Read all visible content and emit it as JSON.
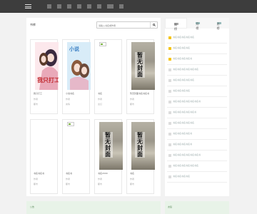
{
  "nav": {
    "items": [
      "首页",
      "分类",
      "排行",
      "完本",
      "书单",
      "入库",
      "更多",
      "书架"
    ]
  },
  "main": {
    "title": "书库",
    "search_placeholder": "请输入书名或作者"
  },
  "books": [
    {
      "title": "我只打工",
      "author": "作者",
      "category": "都市",
      "cover": "art1"
    },
    {
      "title": "小说书名",
      "author": "作者",
      "category": "言情",
      "cover": "art2"
    },
    {
      "title": "书名",
      "author": "作者",
      "category": "玄幻",
      "cover": "broken"
    },
    {
      "title": "暂无封面书名书名书",
      "author": "作者",
      "category": "都市",
      "cover": "none"
    },
    {
      "title": "书名书名书",
      "author": "作者",
      "category": "都市",
      "cover": "blank"
    },
    {
      "title": "书名书",
      "author": "作者",
      "category": "都市",
      "cover": "broken"
    },
    {
      "title": "书名2000",
      "author": "作者",
      "category": "都市",
      "cover": "none"
    },
    {
      "title": "书名",
      "author": "作者",
      "category": "都市",
      "cover": "none"
    }
  ],
  "nocover_text": "暂无封面",
  "side": {
    "tabs": [
      "周榜",
      "月榜",
      "总榜"
    ],
    "rank": [
      "书名书名书名书名书名",
      "书名书名书名书名",
      "书名书名书名书名书",
      "书名书名书名书名书名书名",
      "书名书名书名书名书名",
      "书名书名书名书名",
      "书名书名书名书名书名书名书",
      "书名书名书名书名书名书",
      "书名书名书名书名书名",
      "书名书名书名书名书",
      "书名书名书名书名书",
      "书名书名书名书名书名书名书",
      "书名书名书名书名书名书名",
      "书名书名书名书名"
    ]
  },
  "bottom": {
    "left_label": "公告",
    "right_label": "友链"
  }
}
